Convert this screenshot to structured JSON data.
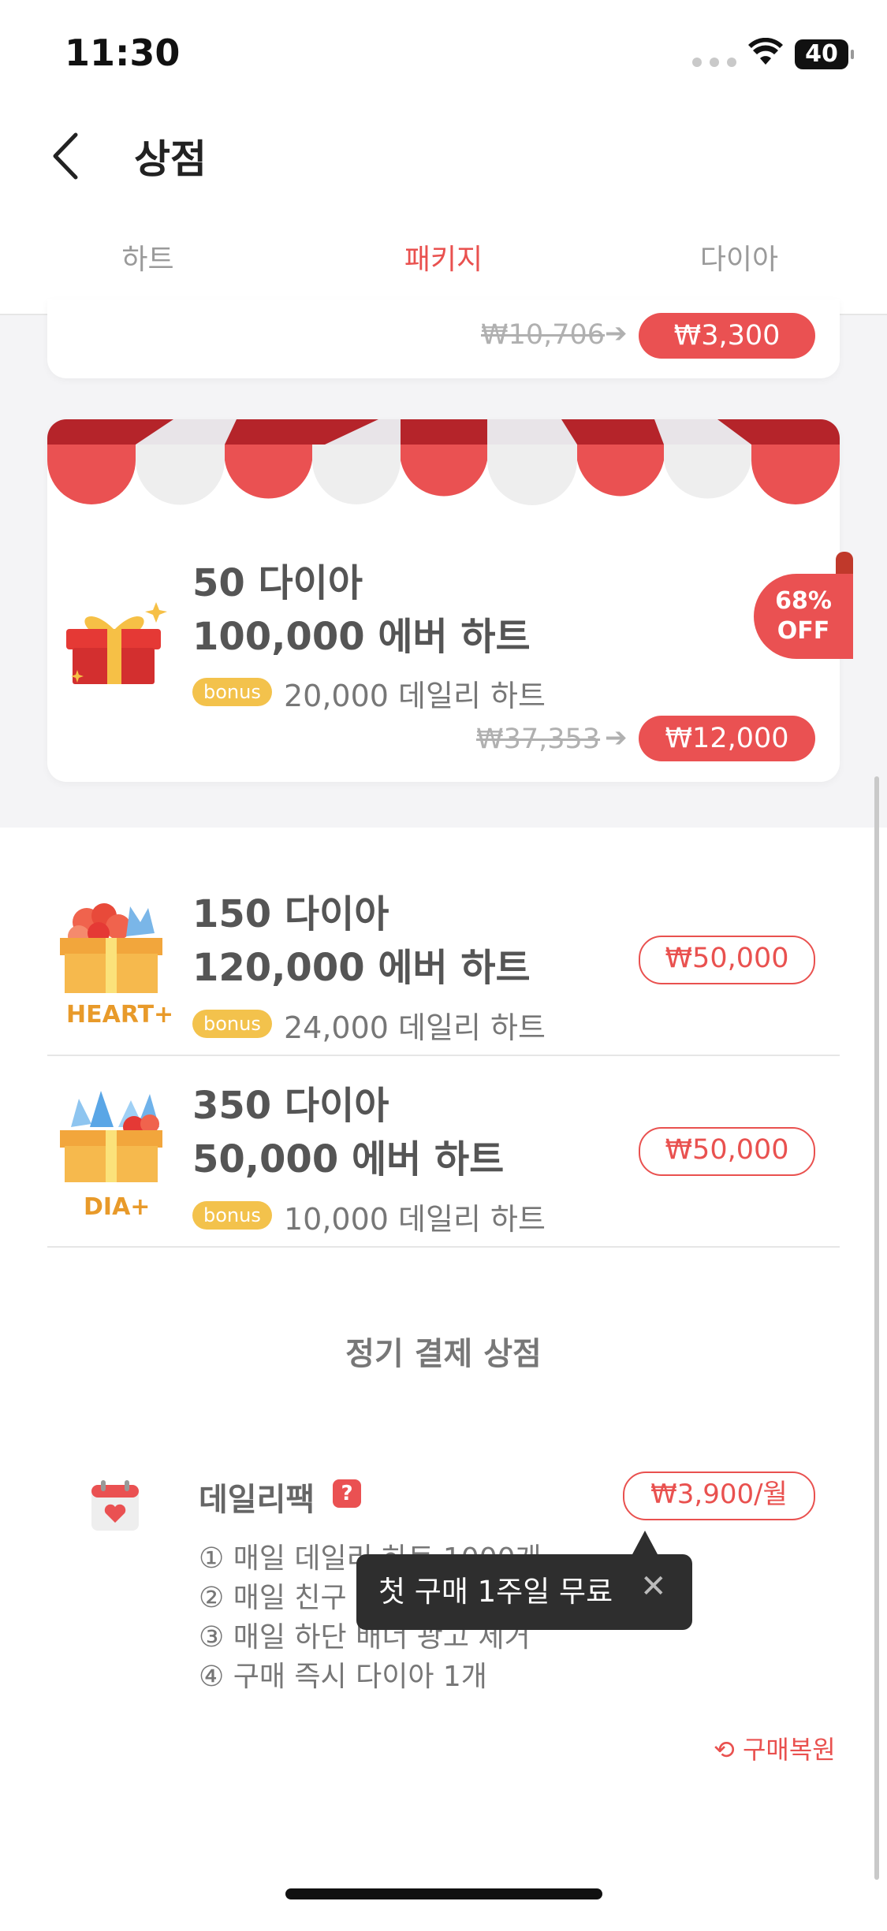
{
  "status_bar": {
    "time": "11:30",
    "battery": "40"
  },
  "header": {
    "title": "상점"
  },
  "tabs": [
    {
      "label": "하트",
      "active": false
    },
    {
      "label": "패키지",
      "active": true
    },
    {
      "label": "다이아",
      "active": false
    }
  ],
  "colors": {
    "accent": "#e9514f",
    "bonus": "#f3c24c",
    "awning_red": "#ea5152",
    "awning_dark": "#b5242a"
  },
  "top_card": {
    "original_price": "₩10,706",
    "price": "₩3,300"
  },
  "featured_package": {
    "line1": "50 다이아",
    "line2": "100,000 에버 하트",
    "bonus_badge": "bonus",
    "bonus_text": "20,000 데일리 하트",
    "original_price": "₩37,353",
    "price": "₩12,000",
    "discount_line1": "68%",
    "discount_line2": "OFF"
  },
  "packages": [
    {
      "icon_label": "HEART+",
      "line1": "150 다이아",
      "line2": "120,000 에버 하트",
      "bonus_badge": "bonus",
      "bonus_text": "24,000 데일리 하트",
      "price": "₩50,000"
    },
    {
      "icon_label": "DIA+",
      "line1": "350 다이아",
      "line2": "50,000 에버 하트",
      "bonus_badge": "bonus",
      "bonus_text": "10,000 데일리 하트",
      "price": "₩50,000"
    }
  ],
  "subscription": {
    "section_title": "정기 결제 상점",
    "name": "데일리팩",
    "help": "?",
    "price": "₩3,900/월",
    "features": [
      "① 매일 데일리 하트 1000개",
      "② 매일 친구",
      "③ 매일 하단 배너 광고 제거",
      "④ 구매 즉시 다이아 1개"
    ],
    "tooltip": "첫 구매 1주일 무료",
    "restore": "구매복원"
  }
}
